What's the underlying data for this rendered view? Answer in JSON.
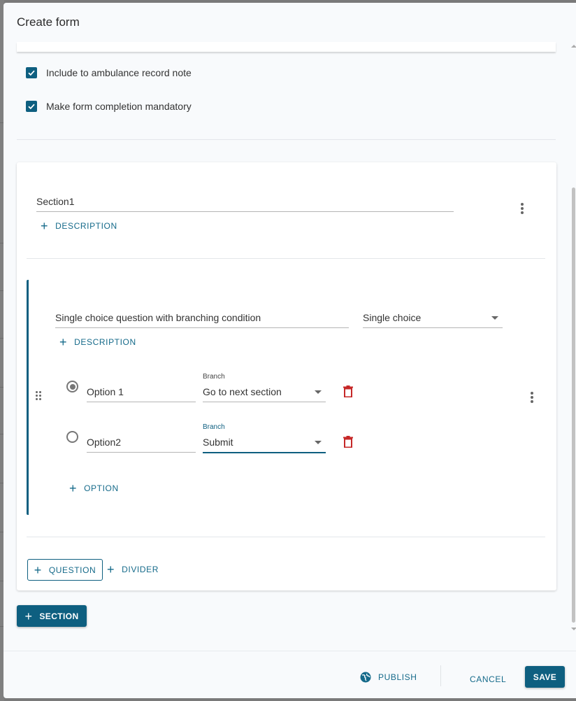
{
  "dialog": {
    "title": "Create form"
  },
  "settings": {
    "checkboxes": [
      {
        "label": "Include to ambulance record note",
        "checked": true
      },
      {
        "label": "Make form completion mandatory",
        "checked": true
      }
    ]
  },
  "section": {
    "title_value": "Section1",
    "add_description_label": "DESCRIPTION",
    "question": {
      "title_value": "Single choice question with branching condition",
      "type_value": "Single choice",
      "add_description_label": "DESCRIPTION",
      "options": [
        {
          "value": "Option 1",
          "selected": true,
          "branch_label": "Branch",
          "branch_value": "Go to next section"
        },
        {
          "value": "Option2",
          "selected": false,
          "branch_label": "Branch",
          "branch_value": "Submit"
        }
      ],
      "add_option_label": "OPTION"
    },
    "add_question_label": "QUESTION",
    "add_divider_label": "DIVIDER"
  },
  "add_section_label": "SECTION",
  "footer": {
    "publish_label": "PUBLISH",
    "cancel_label": "CANCEL",
    "save_label": "SAVE"
  },
  "colors": {
    "primary": "#0e5f80",
    "danger": "#c62828",
    "background": "#f8fafc"
  }
}
